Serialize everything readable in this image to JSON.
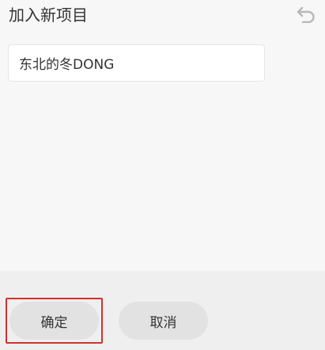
{
  "dialog": {
    "title": "加入新项目",
    "back_icon": "undo-arrow-icon"
  },
  "form": {
    "name_value": "东北的冬DONG"
  },
  "footer": {
    "confirm_label": "确定",
    "cancel_label": "取消",
    "highlight_color": "#d0312d"
  },
  "colors": {
    "background": "#f7f7f7",
    "footer_background": "#efefef",
    "button_background": "#e2e2e2",
    "text": "#333333",
    "icon": "#b8b8b8"
  }
}
